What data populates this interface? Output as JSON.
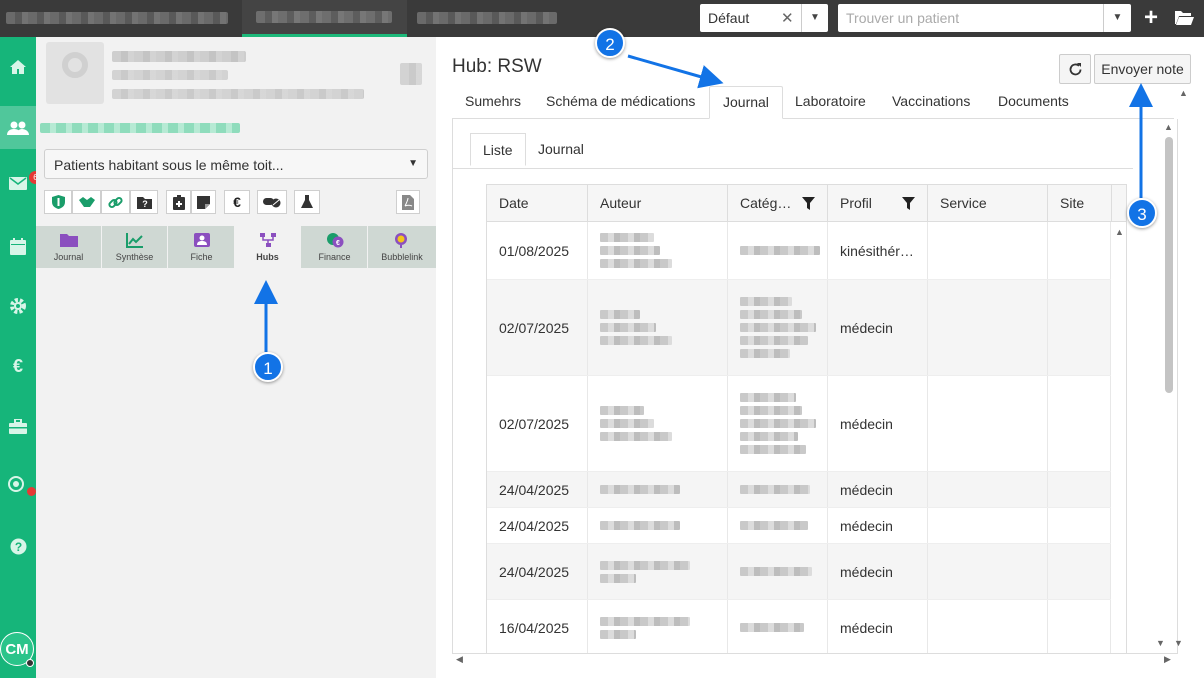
{
  "top": {
    "profile_select": "Défaut",
    "patient_search_placeholder": "Trouver un patient"
  },
  "leftnav": {
    "mail_badge": "6",
    "avatar_initials": "CM"
  },
  "sidepanel": {
    "household_select": "Patients habitant sous le même toit...",
    "euro_button": "€",
    "module_tabs": [
      {
        "label": "Journal"
      },
      {
        "label": "Synthèse"
      },
      {
        "label": "Fiche"
      },
      {
        "label": "Hubs"
      },
      {
        "label": "Finance"
      },
      {
        "label": "Bubblelink"
      }
    ]
  },
  "main": {
    "title": "Hub: RSW",
    "send_note_label": "Envoyer note",
    "tabs": [
      {
        "label": "Sumehrs"
      },
      {
        "label": "Schéma de médications"
      },
      {
        "label": "Journal"
      },
      {
        "label": "Laboratoire"
      },
      {
        "label": "Vaccinations"
      },
      {
        "label": "Documents"
      }
    ],
    "subtabs": [
      {
        "label": "Liste"
      },
      {
        "label": "Journal"
      }
    ],
    "grid": {
      "columns": [
        "Date",
        "Auteur",
        "Catég…",
        "Profil",
        "Service",
        "Site"
      ],
      "rows": [
        {
          "date": "01/08/2025",
          "profil": "kinésithér…"
        },
        {
          "date": "02/07/2025",
          "profil": "médecin"
        },
        {
          "date": "02/07/2025",
          "profil": "médecin"
        },
        {
          "date": "24/04/2025",
          "profil": "médecin"
        },
        {
          "date": "24/04/2025",
          "profil": "médecin"
        },
        {
          "date": "24/04/2025",
          "profil": "médecin"
        },
        {
          "date": "16/04/2025",
          "profil": "médecin"
        }
      ]
    }
  },
  "callouts": [
    "1",
    "2",
    "3"
  ],
  "colors": {
    "brand_green": "#16b57a",
    "callout_blue": "#1273e6",
    "topbar": "#3a3a3a"
  }
}
